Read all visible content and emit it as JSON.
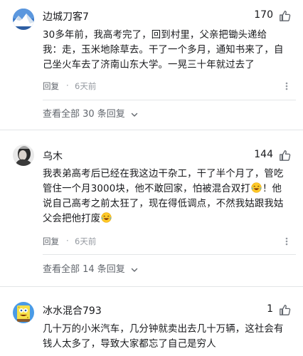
{
  "comments": [
    {
      "username": "边城刀客7",
      "likes": "170",
      "lines": [
        "30多年前，我高考完了，回到村里，父亲把锄头递给",
        "我：走，玉米地除草去。干了一个多月，通知书来了，自",
        "己坐火车去了济南山东大学。一晃三十年就过去了"
      ],
      "reply_label": "回复",
      "dot": "·",
      "time": "6天前",
      "view_all": "查看全部 30 条回复"
    },
    {
      "username": "乌木",
      "likes": "144",
      "lines": [
        "我表弟高考后已经在我这边干杂工，干了半个月了，管吃",
        "管住一个月3000块，他不敢回家，怕被混合双打",
        "！他",
        "说自己高考之前太狂了，现在得低调点，不然我姑跟我姑",
        "父会把他打废"
      ],
      "emoji_names": [
        "laughing-tears-emoji",
        "laughing-tears-emoji"
      ],
      "reply_label": "回复",
      "dot": "·",
      "time": "6天前",
      "view_all": "查看全部 14 条回复"
    },
    {
      "username": "冰水混合793",
      "likes": "1",
      "lines": [
        "几十万的小米汽车，几分钟就卖出去几十万辆，这社会有",
        "钱人太多了，导致大家都忘了自己是穷人"
      ]
    }
  ],
  "icons": {
    "like": "thumbs-up-icon",
    "more": "more-dots-icon",
    "chevron": "chevron-down-icon"
  },
  "colors": {
    "text": "#18191c",
    "secondary": "#61666d",
    "muted": "#9499a0",
    "divider": "#e3e5e7"
  }
}
